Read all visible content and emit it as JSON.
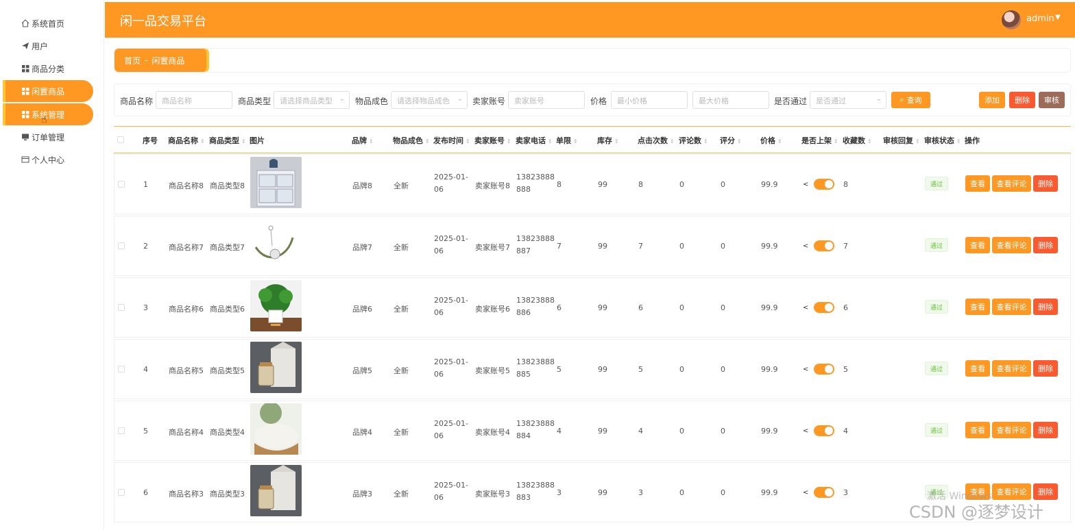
{
  "sidebar": {
    "items": [
      {
        "label": "系统首页",
        "icon": "home-icon"
      },
      {
        "label": "用户",
        "icon": "paper-plane-icon"
      },
      {
        "label": "商品分类",
        "icon": "grid-icon"
      },
      {
        "label": "闲置商品",
        "icon": "grid-icon"
      },
      {
        "label": "系统管理",
        "icon": "grid-icon"
      },
      {
        "label": "订单管理",
        "icon": "monitor-icon"
      },
      {
        "label": "个人中心",
        "icon": "card-icon"
      }
    ]
  },
  "header": {
    "title": "闲一品交易平台",
    "user": "admin"
  },
  "breadcrumb": {
    "home": "首页",
    "sep": "-",
    "current": "闲置商品"
  },
  "filters": {
    "name_label": "商品名称",
    "name_placeholder": "商品名称",
    "type_label": "商品类型",
    "type_placeholder": "请选择商品类型",
    "condition_label": "物品成色",
    "condition_placeholder": "请选择物品成色",
    "seller_label": "卖家账号",
    "seller_placeholder": "卖家账号",
    "price_label": "价格",
    "min_price_placeholder": "最小价格",
    "max_price_placeholder": "最大价格",
    "approved_label": "是否通过",
    "approved_placeholder": "是否通过",
    "search_label": "查询"
  },
  "toolbar": {
    "add": "添加",
    "delete": "删除",
    "review": "审核"
  },
  "columns": [
    "序号",
    "商品名称",
    "商品类型",
    "图片",
    "品牌",
    "物品成色",
    "发布时间",
    "卖家账号",
    "卖家电话",
    "单限",
    "库存",
    "点击次数",
    "评论数",
    "评分",
    "价格",
    "是否上架",
    "收藏数",
    "审核回复",
    "审核状态",
    "操作"
  ],
  "rows": [
    {
      "idx": "1",
      "name": "商品名称8",
      "type": "商品类型8",
      "brand": "品牌8",
      "condition": "全新",
      "date": "2025-01-06",
      "seller": "卖家账号8",
      "phone": "13823888888",
      "limit": "8",
      "stock": "99",
      "clicks": "8",
      "comments": "0",
      "score": "0",
      "price": "99.9",
      "fav": "8",
      "status": "通过",
      "image": "storage-drawers"
    },
    {
      "idx": "2",
      "name": "商品名称7",
      "type": "商品类型7",
      "brand": "品牌7",
      "condition": "全新",
      "date": "2025-01-06",
      "seller": "卖家账号7",
      "phone": "13823888887",
      "limit": "7",
      "stock": "99",
      "clicks": "7",
      "comments": "0",
      "score": "0",
      "price": "99.9",
      "fav": "7",
      "status": "通过",
      "image": "bracelet"
    },
    {
      "idx": "3",
      "name": "商品名称6",
      "type": "商品类型6",
      "brand": "品牌6",
      "condition": "全新",
      "date": "2025-01-06",
      "seller": "卖家账号6",
      "phone": "13823888886",
      "limit": "6",
      "stock": "99",
      "clicks": "6",
      "comments": "0",
      "score": "0",
      "price": "99.9",
      "fav": "6",
      "status": "通过",
      "image": "potted-plant"
    },
    {
      "idx": "4",
      "name": "商品名称5",
      "type": "商品类型5",
      "brand": "品牌5",
      "condition": "全新",
      "date": "2025-01-06",
      "seller": "卖家账号5",
      "phone": "13823888885",
      "limit": "5",
      "stock": "99",
      "clicks": "5",
      "comments": "0",
      "score": "0",
      "price": "99.9",
      "fav": "5",
      "status": "通过",
      "image": "gift-jar"
    },
    {
      "idx": "5",
      "name": "商品名称4",
      "type": "商品类型4",
      "brand": "品牌4",
      "condition": "全新",
      "date": "2025-01-06",
      "seller": "卖家账号4",
      "phone": "13823888884",
      "limit": "4",
      "stock": "99",
      "clicks": "4",
      "comments": "0",
      "score": "0",
      "price": "99.9",
      "fav": "4",
      "status": "通过",
      "image": "flour-bowl"
    },
    {
      "idx": "6",
      "name": "商品名称3",
      "type": "商品类型3",
      "brand": "品牌3",
      "condition": "全新",
      "date": "2025-01-06",
      "seller": "卖家账号3",
      "phone": "13823888883",
      "limit": "3",
      "stock": "99",
      "clicks": "3",
      "comments": "0",
      "score": "0",
      "price": "99.9",
      "fav": "3",
      "status": "通过",
      "image": "gift-jar"
    }
  ],
  "row_actions": {
    "view": "查看",
    "view_comments": "查看评论",
    "delete": "删除"
  },
  "watermark": "CSDN @逐梦设计",
  "activate_text": "激活 Windows",
  "colors": {
    "accent": "#ff9823",
    "accent_light": "#ffc533",
    "danger": "#fa5a2f",
    "review": "#9d6b5a",
    "success": "#67c23a"
  }
}
